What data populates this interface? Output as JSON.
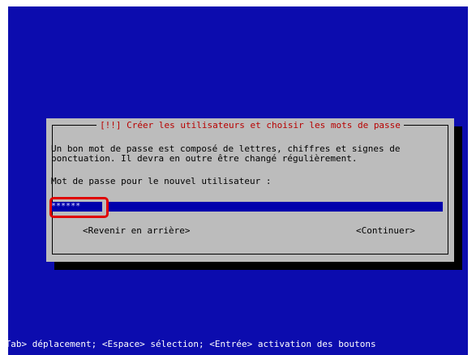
{
  "dialog": {
    "title": "[!!] Créer les utilisateurs et choisir les mots de passe",
    "description_line1": "Un bon mot de passe est composé de lettres, chiffres et signes de",
    "description_line2": "ponctuation. Il devra en outre être changé régulièrement.",
    "prompt": "Mot de passe pour le nouvel utilisateur :",
    "password_value": "******",
    "back_button": "<Revenir en arrière>",
    "continue_button": "<Continuer>"
  },
  "status_bar": "<Tab> déplacement; <Espace> sélection; <Entrée> activation des boutons",
  "colors": {
    "screen_bg": "#0c0cae",
    "dialog_bg": "#bcbcbc",
    "title_text": "#b80000",
    "field_bg": "#0000ac",
    "highlight": "#e00000"
  }
}
